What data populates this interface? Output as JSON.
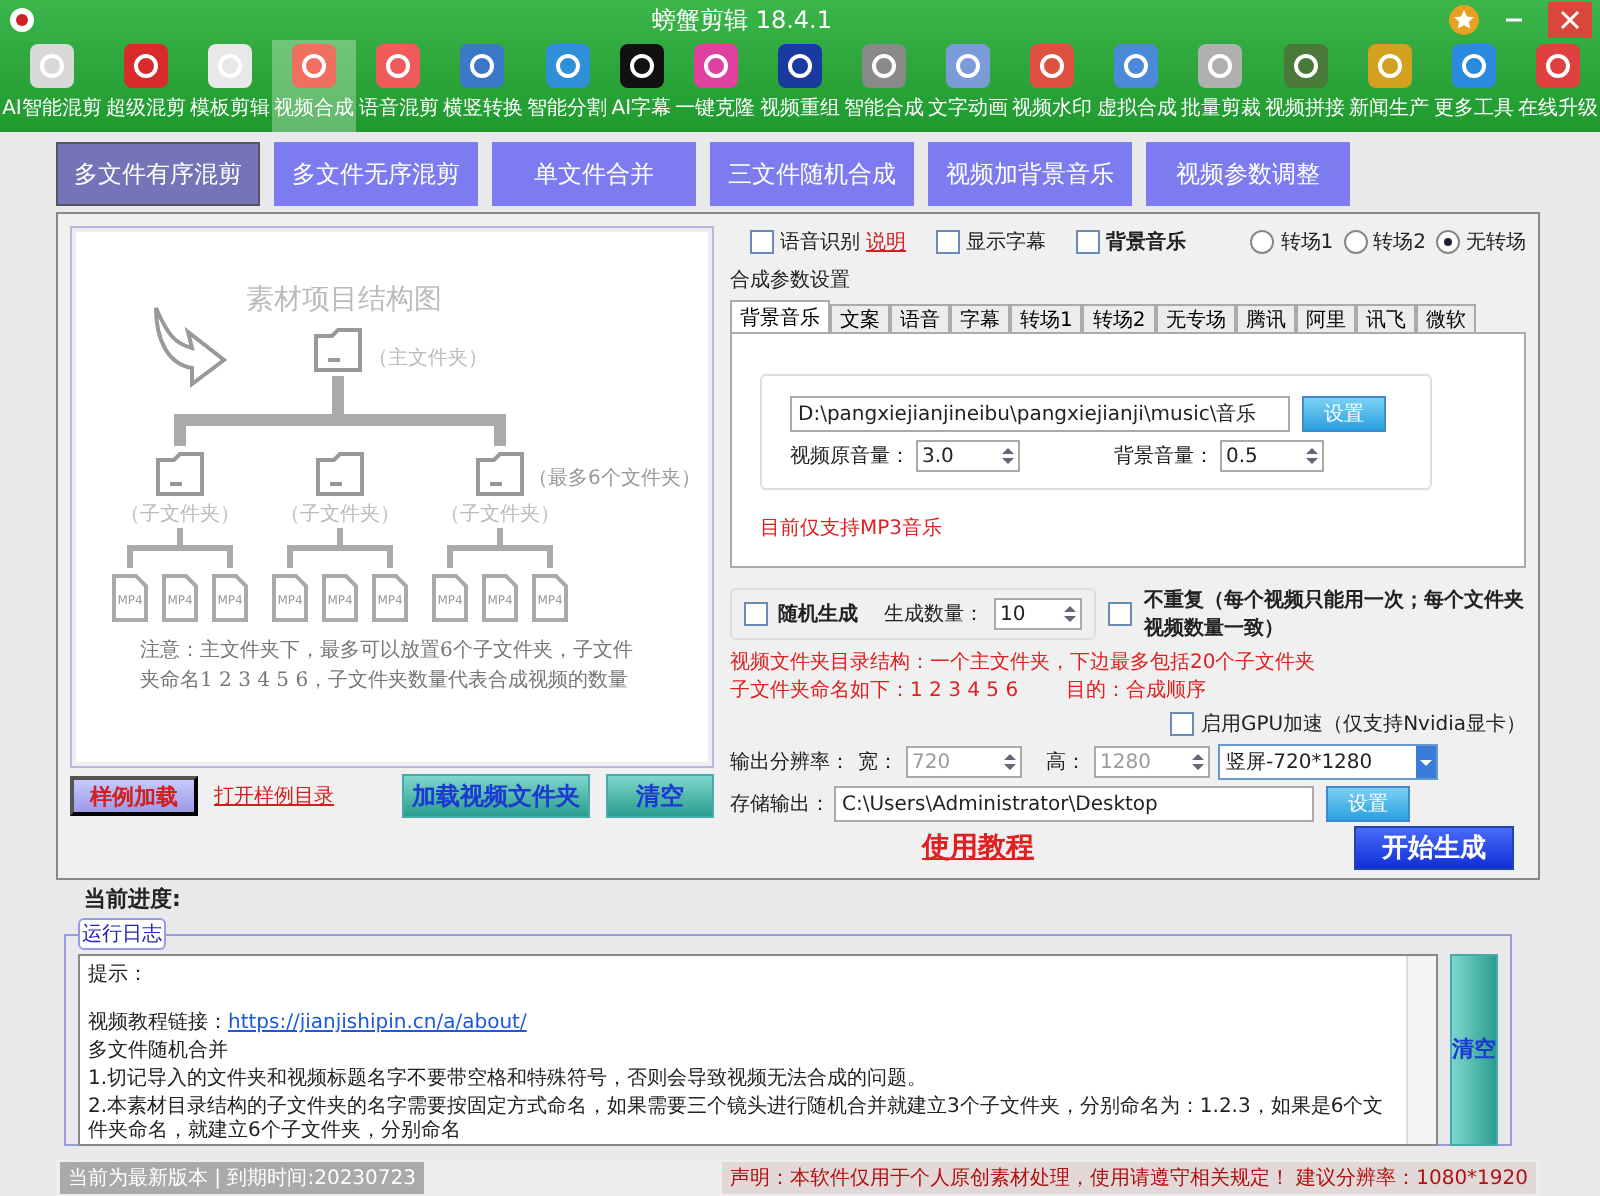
{
  "window": {
    "title": "螃蟹剪辑 18.4.1"
  },
  "toolbar": [
    {
      "label": "AI智能混剪",
      "selected": false
    },
    {
      "label": "超级混剪",
      "selected": false
    },
    {
      "label": "模板剪辑",
      "selected": false
    },
    {
      "label": "视频合成",
      "selected": true
    },
    {
      "label": "语音混剪",
      "selected": false
    },
    {
      "label": "横竖转换",
      "selected": false
    },
    {
      "label": "智能分割",
      "selected": false
    },
    {
      "label": "AI字幕",
      "selected": false
    },
    {
      "label": "一键克隆",
      "selected": false
    },
    {
      "label": "视频重组",
      "selected": false
    },
    {
      "label": "智能合成",
      "selected": false
    },
    {
      "label": "文字动画",
      "selected": false
    },
    {
      "label": "视频水印",
      "selected": false
    },
    {
      "label": "虚拟合成",
      "selected": false
    },
    {
      "label": "批量剪裁",
      "selected": false
    },
    {
      "label": "视频拼接",
      "selected": false
    },
    {
      "label": "新闻生产",
      "selected": false
    },
    {
      "label": "更多工具",
      "selected": false
    },
    {
      "label": "在线升级",
      "selected": false
    }
  ],
  "tabs": [
    {
      "label": "多文件有序混剪",
      "selected": true
    },
    {
      "label": "多文件无序混剪",
      "selected": false
    },
    {
      "label": "单文件合并",
      "selected": false
    },
    {
      "label": "三文件随机合成",
      "selected": false
    },
    {
      "label": "视频加背景音乐",
      "selected": false
    },
    {
      "label": "视频参数调整",
      "selected": false
    }
  ],
  "diagram": {
    "title": "素材项目结构图",
    "main_folder": "（主文件夹）",
    "max_note": "（最多6个文件夹）",
    "sub_folders": [
      {
        "label": "（子文件夹）",
        "files": [
          "MP4",
          "MP4",
          "MP4"
        ]
      },
      {
        "label": "（子文件夹）",
        "files": [
          "MP4",
          "MP4",
          "MP4"
        ]
      },
      {
        "label": "（子文件夹）",
        "files": [
          "MP4",
          "MP4",
          "MP4"
        ]
      }
    ],
    "note": "注意：主文件夹下，最多可以放置6个子文件夹，子文件夹命名1 2 3 4 5 6，子文件夹数量代表合成视频的数量"
  },
  "left_actions": {
    "load_sample": "样例加载",
    "open_sample_dir": "打开样例目录",
    "load_folder": "加载视频文件夹",
    "clear": "清空"
  },
  "options": {
    "checks": [
      {
        "label": "语音识别",
        "checked": false,
        "link": "说明"
      },
      {
        "label": "显示字幕",
        "checked": false
      },
      {
        "label": "背景音乐",
        "checked": false
      }
    ],
    "transitions": [
      {
        "label": "转场1",
        "selected": false
      },
      {
        "label": "转场2",
        "selected": false
      },
      {
        "label": "无转场",
        "selected": true
      }
    ]
  },
  "params": {
    "title": "合成参数设置",
    "tabs": [
      {
        "label": "背景音乐",
        "selected": true
      },
      {
        "label": "文案",
        "selected": false
      },
      {
        "label": "语音",
        "selected": false
      },
      {
        "label": "字幕",
        "selected": false
      },
      {
        "label": "转场1",
        "selected": false
      },
      {
        "label": "转场2",
        "selected": false
      },
      {
        "label": "无专场",
        "selected": false
      },
      {
        "label": "腾讯",
        "selected": false
      },
      {
        "label": "阿里",
        "selected": false
      },
      {
        "label": "讯飞",
        "selected": false
      },
      {
        "label": "微软",
        "selected": false
      }
    ],
    "music_path": "D:\\pangxiejianjineibu\\pangxiejianji\\music\\音乐",
    "set_button": "设置",
    "original_volume": {
      "label": "视频原音量：",
      "value": "3.0"
    },
    "background_volume": {
      "label": "背景音量：",
      "value": "0.5"
    },
    "note": "目前仅支持MP3音乐"
  },
  "generate": {
    "random": {
      "label": "随机生成",
      "checked": false
    },
    "count": {
      "label": "生成数量：",
      "value": "10"
    },
    "no_repeat": {
      "label": "不重复（每个视频只能用一次；每个文件夹视频数量一致）",
      "checked": false
    }
  },
  "notes": [
    "视频文件夹目录结构：一个主文件夹，下边最多包括20个子文件夹",
    "子文件夹命名如下：1 2 3 4 5 6",
    "目的：合成顺序"
  ],
  "gpu": {
    "label": "启用GPU加速（仅支持Nvidia显卡）",
    "checked": false
  },
  "resolution": {
    "label": "输出分辨率：",
    "width": {
      "label": "宽：",
      "value": "720",
      "disabled": true
    },
    "height": {
      "label": "高：",
      "value": "1280",
      "disabled": true
    },
    "preset": "竖屏-720*1280"
  },
  "output": {
    "label": "存储输出：",
    "path": "C:\\Users\\Administrator\\Desktop",
    "set_button": "设置"
  },
  "tutorial": "使用教程",
  "start_button": "开始生成",
  "progress_label": "当前进度:",
  "log": {
    "title": "运行日志",
    "lines": [
      {
        "kind": "text",
        "text": "提示："
      },
      {
        "kind": "link",
        "text": "视频教程链接：",
        "link": "https://jianjishipin.cn/a/about/"
      },
      {
        "kind": "text",
        "text": "多文件随机合并"
      },
      {
        "kind": "text",
        "text": "1.切记导入的文件夹和视频标题名字不要带空格和特殊符号，否则会导致视频无法合成的问题。"
      },
      {
        "kind": "text",
        "text": "2.本素材目录结构的子文件夹的名字需要按固定方式命名，如果需要三个镜头进行随机合并就建立3个子文件夹，分别命名为：1.2.3，如果是6个文件夹命名，就建立6个子文件夹，分别命名"
      }
    ],
    "clear": "清空"
  },
  "status": {
    "version": "当前为最新版本 | 到期时间:20230723",
    "notice": "声明：本软件仅用于个人原创素材处理，使用请遵守相关规定！ 建议分辨率：1080*1920"
  }
}
